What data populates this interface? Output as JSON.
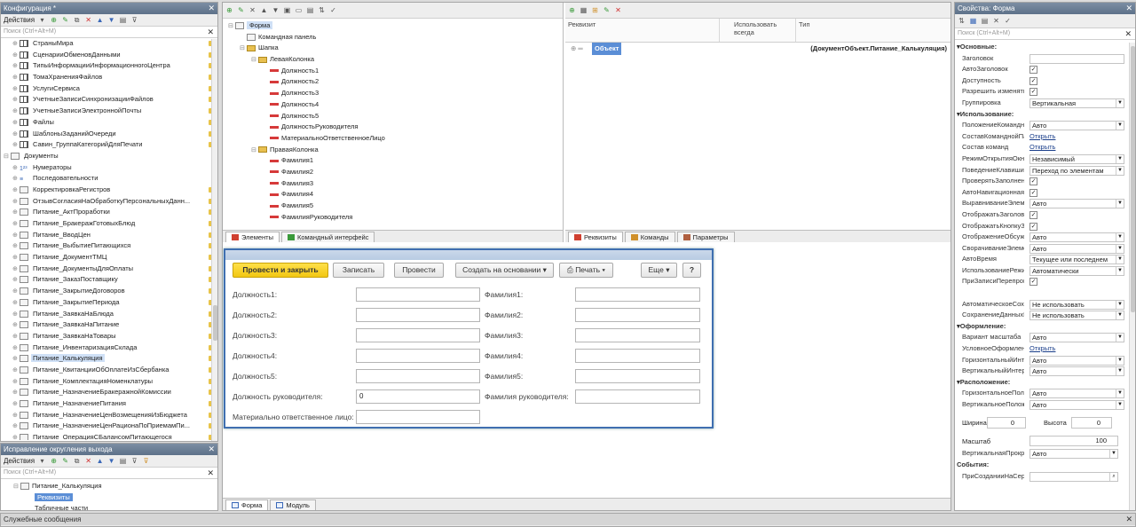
{
  "config_panel": {
    "title": "Конфигурация *",
    "actions_label": "Действия",
    "search_placeholder": "Поиск (Ctrl+Alt+M)",
    "items": [
      {
        "label": "СтраныМира",
        "icon": "table-icon",
        "indent": 1
      },
      {
        "label": "СценарииОбменовДанными",
        "icon": "table-icon",
        "indent": 1
      },
      {
        "label": "ТипыИнформацииИнформационногоЦентра",
        "icon": "table-icon",
        "indent": 1
      },
      {
        "label": "ТомаХраненияФайлов",
        "icon": "table-icon",
        "indent": 1
      },
      {
        "label": "УслугиСервиса",
        "icon": "table-icon",
        "indent": 1
      },
      {
        "label": "УчетныеЗаписиСинхронизацииФайлов",
        "icon": "table-icon",
        "indent": 1
      },
      {
        "label": "УчетныеЗаписиЭлектроннойПочты",
        "icon": "table-icon",
        "indent": 1
      },
      {
        "label": "Файлы",
        "icon": "table-icon",
        "indent": 1
      },
      {
        "label": "ШаблоныЗаданийОчереди",
        "icon": "table-icon",
        "indent": 1
      },
      {
        "label": "Савин_ГруппаКатегорийДляПечати",
        "icon": "table-icon",
        "indent": 1
      },
      {
        "label": "Документы",
        "icon": "document-icon",
        "indent": 0
      },
      {
        "label": "Нумераторы",
        "icon": "numerator-icon",
        "indent": 1
      },
      {
        "label": "Последовательности",
        "icon": "sequence-icon",
        "indent": 1
      },
      {
        "label": "КорректировкаРегистров",
        "icon": "document-icon",
        "indent": 1
      },
      {
        "label": "ОтзывСогласияНаОбработкуПерсональныхДанн...",
        "icon": "document-icon",
        "indent": 1
      },
      {
        "label": "Питание_АктПроработки",
        "icon": "document-icon",
        "indent": 1
      },
      {
        "label": "Питание_БракеражГотовыхБлюд",
        "icon": "document-icon",
        "indent": 1
      },
      {
        "label": "Питание_ВводЦен",
        "icon": "document-icon",
        "indent": 1
      },
      {
        "label": "Питание_ВыбытиеПитающихся",
        "icon": "document-icon",
        "indent": 1
      },
      {
        "label": "Питание_ДокументТМЦ",
        "icon": "document-icon",
        "indent": 1
      },
      {
        "label": "Питание_ДокументыДляОплаты",
        "icon": "document-icon",
        "indent": 1
      },
      {
        "label": "Питание_ЗаказПоставщику",
        "icon": "document-icon",
        "indent": 1
      },
      {
        "label": "Питание_ЗакрытиеДоговоров",
        "icon": "document-icon",
        "indent": 1
      },
      {
        "label": "Питание_ЗакрытиеПериода",
        "icon": "document-icon",
        "indent": 1
      },
      {
        "label": "Питание_ЗаявкаНаБлюда",
        "icon": "document-icon",
        "indent": 1
      },
      {
        "label": "Питание_ЗаявкаНаПитание",
        "icon": "document-icon",
        "indent": 1
      },
      {
        "label": "Питание_ЗаявкаНаТовары",
        "icon": "document-icon",
        "indent": 1
      },
      {
        "label": "Питание_ИнвентаризацияСклада",
        "icon": "document-icon",
        "indent": 1
      },
      {
        "label": "Питание_Калькуляция",
        "icon": "document-icon",
        "indent": 1,
        "selected": true
      },
      {
        "label": "Питание_КвитанцииОбОплатеИзСбербанка",
        "icon": "document-icon",
        "indent": 1
      },
      {
        "label": "Питание_КомплектацияНоменклатуры",
        "icon": "document-icon",
        "indent": 1
      },
      {
        "label": "Питание_НазначениеБракеражнойКомиссии",
        "icon": "document-icon",
        "indent": 1
      },
      {
        "label": "Питание_НазначениеПитания",
        "icon": "document-icon",
        "indent": 1
      },
      {
        "label": "Питание_НазначениеЦенВозмещенияИзБюджета",
        "icon": "document-icon",
        "indent": 1
      },
      {
        "label": "Питание_НазначениеЦенРационаПоПриемамПи...",
        "icon": "document-icon",
        "indent": 1
      },
      {
        "label": "Питание_ОперацияСБалансомПитающегося",
        "icon": "document-icon",
        "indent": 1
      }
    ]
  },
  "rounding_panel": {
    "title": "Исправление округления выхода",
    "actions_label": "Действия",
    "search_placeholder": "Поиск (Ctrl+Alt+M)",
    "items": [
      {
        "label": "Питание_Калькуляция",
        "indent": 0
      },
      {
        "label": "Реквизиты",
        "indent": 1,
        "selected": true
      },
      {
        "label": "Табличные части",
        "indent": 1
      }
    ]
  },
  "form_tree": {
    "items": [
      {
        "label": "Форма",
        "indent": 0,
        "icon": "form-icon",
        "selected": true
      },
      {
        "label": "Командная панель",
        "indent": 1,
        "icon": "command-panel-icon"
      },
      {
        "label": "Шапка",
        "indent": 1,
        "icon": "folder-icon"
      },
      {
        "label": "ЛеваяКолонка",
        "indent": 2,
        "icon": "folder-icon"
      },
      {
        "label": "Должность1",
        "indent": 3,
        "icon": "field-icon"
      },
      {
        "label": "Должность2",
        "indent": 3,
        "icon": "field-icon"
      },
      {
        "label": "Должность3",
        "indent": 3,
        "icon": "field-icon"
      },
      {
        "label": "Должность4",
        "indent": 3,
        "icon": "field-icon"
      },
      {
        "label": "Должность5",
        "indent": 3,
        "icon": "field-icon"
      },
      {
        "label": "ДолжностьРуководителя",
        "indent": 3,
        "icon": "field-icon"
      },
      {
        "label": "МатериальноОтветственноеЛицо",
        "indent": 3,
        "icon": "field-icon"
      },
      {
        "label": "ПраваяКолонка",
        "indent": 2,
        "icon": "folder-icon"
      },
      {
        "label": "Фамилия1",
        "indent": 3,
        "icon": "field-icon"
      },
      {
        "label": "Фамилия2",
        "indent": 3,
        "icon": "field-icon"
      },
      {
        "label": "Фамилия3",
        "indent": 3,
        "icon": "field-icon"
      },
      {
        "label": "Фамилия4",
        "indent": 3,
        "icon": "field-icon"
      },
      {
        "label": "Фамилия5",
        "indent": 3,
        "icon": "field-icon"
      },
      {
        "label": "ФамилияРуководителя",
        "indent": 3,
        "icon": "field-icon"
      }
    ],
    "tabs": [
      "Элементы",
      "Командный интерфейс"
    ]
  },
  "attributes": {
    "headers": {
      "name": "Реквизит",
      "always": "Использовать всегда",
      "type": "Тип"
    },
    "object_label": "Объект",
    "object_type": "(ДокументОбъект.Питание_Калькуляция)",
    "tabs": [
      "Реквизиты",
      "Команды",
      "Параметры"
    ]
  },
  "preview": {
    "buttons": {
      "post_close": "Провести и закрыть",
      "save": "Записать",
      "post": "Провести",
      "create_based": "Создать на основании",
      "print": "Печать",
      "more": "Еще",
      "help": "?"
    },
    "left_fields": [
      {
        "label": "Должность1:",
        "value": ""
      },
      {
        "label": "Должность2:",
        "value": ""
      },
      {
        "label": "Должность3:",
        "value": ""
      },
      {
        "label": "Должность4:",
        "value": ""
      },
      {
        "label": "Должность5:",
        "value": ""
      },
      {
        "label": "Должность руководителя:",
        "value": "0"
      },
      {
        "label": "Материально ответственное лицо:",
        "value": ""
      }
    ],
    "right_fields": [
      {
        "label": "Фамилия1:",
        "value": ""
      },
      {
        "label": "Фамилия2:",
        "value": ""
      },
      {
        "label": "Фамилия3:",
        "value": ""
      },
      {
        "label": "Фамилия4:",
        "value": ""
      },
      {
        "label": "Фамилия5:",
        "value": ""
      },
      {
        "label": "Фамилия руководителя:",
        "value": ""
      }
    ],
    "bottom_tabs": [
      "Форма",
      "Модуль"
    ]
  },
  "properties": {
    "title": "Свойства: Форма",
    "search_placeholder": "Поиск (Ctrl+Alt+M)",
    "rows": [
      {
        "kind": "group",
        "label": "Основные:"
      },
      {
        "kind": "text",
        "label": "Заголовок",
        "value": ""
      },
      {
        "kind": "check",
        "label": "АвтоЗаголовок",
        "value": "✓"
      },
      {
        "kind": "check",
        "label": "Доступность",
        "value": "✓"
      },
      {
        "kind": "check",
        "label": "Разрешить изменять",
        "value": "✓"
      },
      {
        "kind": "select",
        "label": "Группировка",
        "value": "Вертикальная"
      },
      {
        "kind": "group",
        "label": "Использование:"
      },
      {
        "kind": "select",
        "label": "ПоложениеКоманднойПанели",
        "value": "Авто"
      },
      {
        "kind": "link",
        "label": "СоставКоманднойПанели",
        "value": "Открыть"
      },
      {
        "kind": "link",
        "label": "Состав команд",
        "value": "Открыть"
      },
      {
        "kind": "select",
        "label": "РежимОткрытияОкна",
        "value": "Независимый"
      },
      {
        "kind": "select",
        "label": "ПоведениеКлавишиEnter",
        "value": "Переход по элементам"
      },
      {
        "kind": "check",
        "label": "ПроверятьЗаполнение",
        "value": "✓"
      },
      {
        "kind": "check",
        "label": "АвтоНавигационнаяСсылка",
        "value": "✓"
      },
      {
        "kind": "select",
        "label": "ВыравниваниеЭлементов",
        "value": "Авто"
      },
      {
        "kind": "check",
        "label": "ОтображатьЗаголовок",
        "value": "✓"
      },
      {
        "kind": "check",
        "label": "ОтображатьКнопкуЗакрытия",
        "value": "✓"
      },
      {
        "kind": "select",
        "label": "ОтображениеОбсуждений",
        "value": "Авто"
      },
      {
        "kind": "select",
        "label": "СворачиваниеЭлементов",
        "value": "Авто"
      },
      {
        "kind": "select",
        "label": "АвтоВремя",
        "value": "Текущее или последнем"
      },
      {
        "kind": "select",
        "label": "ИспользованиеРежимаПроведения",
        "value": "Автоматически"
      },
      {
        "kind": "check",
        "label": "ПриЗаписиПерепроводить",
        "value": "✓"
      },
      {
        "kind": "blank",
        "label": ""
      },
      {
        "kind": "select",
        "label": "АвтоматическоеСохранение",
        "value": "Не использовать"
      },
      {
        "kind": "select",
        "label": "СохранениеДанныхВНастройках",
        "value": "Не использовать"
      },
      {
        "kind": "group",
        "label": "Оформление:"
      },
      {
        "kind": "select",
        "label": "Вариант масштаба",
        "value": "Авто"
      },
      {
        "kind": "link",
        "label": "УсловноеОформление",
        "value": "Открыть"
      },
      {
        "kind": "select",
        "label": "ГоризонтальныйИнтервал",
        "value": "Авто"
      },
      {
        "kind": "select",
        "label": "ВертикальныйИнтервал",
        "value": "Авто"
      },
      {
        "kind": "group",
        "label": "Расположение:"
      },
      {
        "kind": "select",
        "label": "ГоризонтальноеПоложение",
        "value": "Авто"
      },
      {
        "kind": "select",
        "label": "ВертикальноеПоложение",
        "value": "Авто"
      }
    ],
    "width_label": "Ширина",
    "width_value": "0",
    "height_label": "Высота",
    "height_value": "0",
    "scale_label": "Масштаб",
    "scale_value": "100",
    "vscroll_label": "ВертикальнаяПрокрутка",
    "vscroll_value": "Авто",
    "events_label": "События:",
    "on_create_label": "ПриСозданииНаСервере"
  },
  "messages_panel": {
    "title": "Служебные сообщения"
  }
}
